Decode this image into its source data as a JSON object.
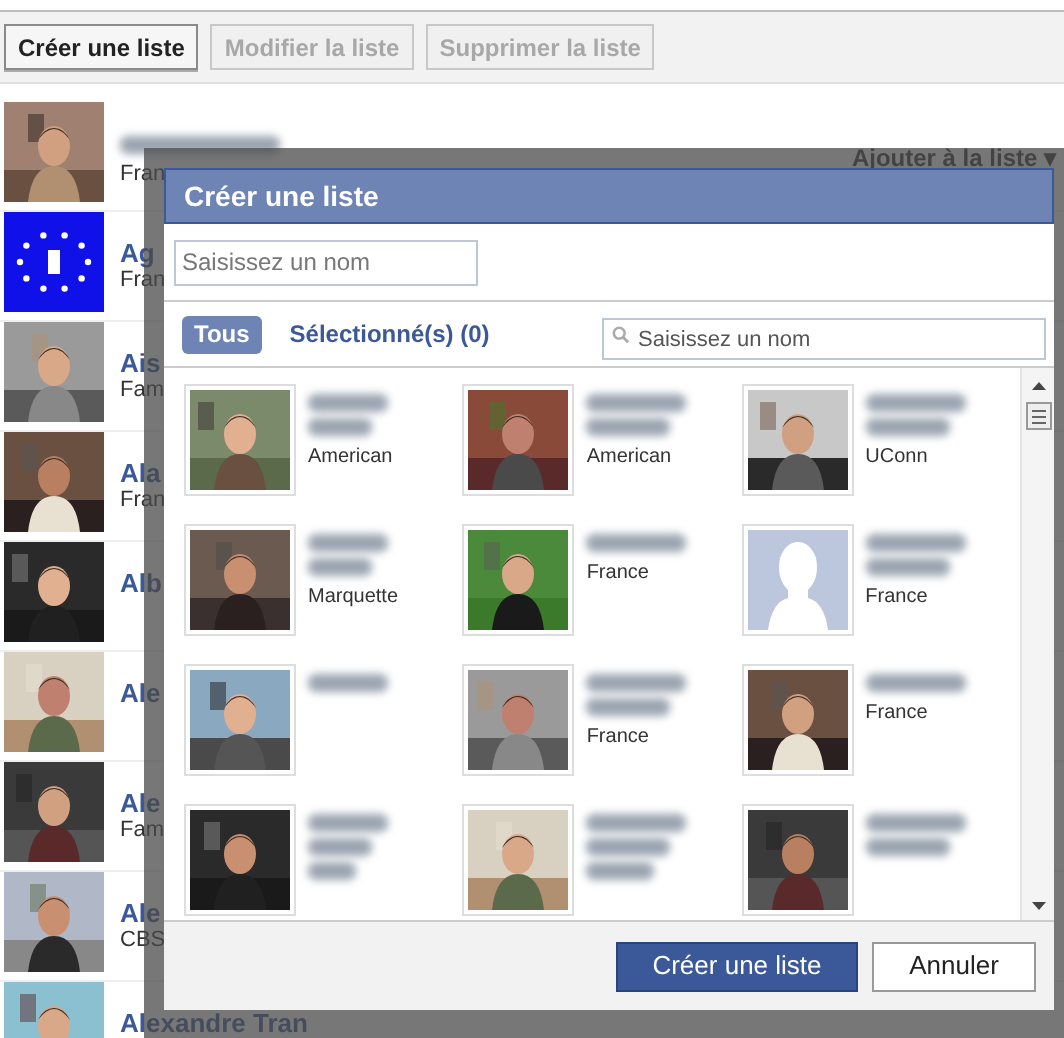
{
  "toolbar": {
    "buttons": [
      {
        "label": "Créer une liste",
        "disabled": false
      },
      {
        "label": "Modifier la liste",
        "disabled": true
      },
      {
        "label": "Supprimer la liste",
        "disabled": true
      }
    ]
  },
  "friends": [
    {
      "subtitle": "Fran",
      "list_menu": "Ajouter à la liste ▾"
    },
    {
      "name": "Ag",
      "subtitle": "Fran"
    },
    {
      "name": "Ais",
      "subtitle": "Fam"
    },
    {
      "name": "Ala",
      "subtitle": "Fran"
    },
    {
      "name": "Alb"
    },
    {
      "name": "Ale"
    },
    {
      "name": "Ale",
      "subtitle": "Fam"
    },
    {
      "name": "Ale",
      "subtitle": "CBS"
    },
    {
      "name": "Alexandre Tran"
    }
  ],
  "dialog": {
    "title": "Créer une liste",
    "name_field": {
      "placeholder": "Saisissez un nom"
    },
    "filters": [
      {
        "label": "Tous",
        "selected": true
      },
      {
        "label": "Sélectionné(s) (0)",
        "selected": false
      }
    ],
    "search": {
      "placeholder": "Saisissez un nom"
    },
    "people": [
      {
        "kind": "picture",
        "subtitle": "American"
      },
      {
        "kind": "picture",
        "subtitle": "American"
      },
      {
        "kind": "picture",
        "subtitle": "UConn"
      },
      {
        "kind": "picture",
        "subtitle": "Marquette"
      },
      {
        "kind": "picture",
        "subtitle": "France"
      },
      {
        "kind": "silhouette",
        "subtitle": "France"
      },
      {
        "kind": "picture"
      },
      {
        "kind": "picture",
        "subtitle": "France"
      },
      {
        "kind": "picture",
        "subtitle": "France"
      },
      {
        "kind": "picture"
      },
      {
        "kind": "picture"
      },
      {
        "kind": "picture"
      }
    ],
    "buttons": [
      {
        "label": "Créer une liste",
        "kind": "primary"
      },
      {
        "label": "Annuler",
        "kind": "secondary"
      }
    ]
  }
}
